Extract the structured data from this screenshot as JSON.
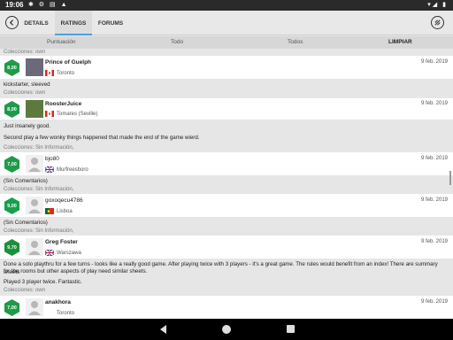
{
  "status": {
    "time": "19:06",
    "icons": "✱ ⚙ ▤ ▲",
    "right": "▾◢ ▮"
  },
  "tabs": {
    "details": "DETAILS",
    "ratings": "RATINGS",
    "forums": "FORUMS"
  },
  "filters": {
    "rating": "Puntuación",
    "all": "Todo",
    "all_pl": "Todos",
    "clear": "LIMPIAR"
  },
  "colors": {
    "green_dark": "#1e9a4a",
    "green_mid": "#2aa84a",
    "accent": "#4aa0d8"
  },
  "ratings": [
    {
      "coleccion": "Colecciones:  own",
      "score": "8,00",
      "username": "Prince of Guelph",
      "location": "Toronto",
      "date": "9 feb. 2019",
      "comment": "kickstarter, sleeved",
      "avatar": "photo",
      "flag": "canada-flag-icon"
    },
    {
      "coleccion": "Colecciones:  own",
      "score": "8,00",
      "username": "RoosterJuice",
      "location": "Tomares (Seville)",
      "date": "9 feb. 2019",
      "comment1": "Just insanely good.",
      "comment2": "Second play a few wonky things happened that made the end of the game wierd.",
      "avatar": "photo",
      "flag": "canada-flag-icon"
    },
    {
      "coleccion": "Colecciones:  Sin Información,",
      "score": "7,00",
      "username": "bjo80",
      "location": "Murfreesboro",
      "date": "9 feb. 2019",
      "comment": "(Sin Comentarios)",
      "avatar": "generic",
      "flag": "uk-flag-icon"
    },
    {
      "coleccion": "Colecciones:  Sin Información,",
      "score": "9,00",
      "username": "goxoqecu4786",
      "location": "Lisboa",
      "date": "9 feb. 2019",
      "comment": "(Sin Comentarios)",
      "avatar": "generic",
      "flag": "portugal-flag-icon"
    },
    {
      "coleccion": "Colecciones:  Sin Información,",
      "score": "9,70",
      "username": "Greg Foster",
      "location": "Warszawa",
      "date": "9 feb. 2019",
      "comment1": "Done a solo playthru for a few turns - looks like a really good game. After playing twice with 3 players - it's a great game. The rules would benefit from an index! There are summary sheets",
      "comment2": "for the rooms but other aspects of play need similar sheets.",
      "comment3": "Played 3 player twice. Fantastic.",
      "avatar": "generic",
      "flag": "uk-flag-icon"
    },
    {
      "coleccion": "Colecciones:  own",
      "score": "7,00",
      "username": "anakhora",
      "location": "Toronto",
      "date": "9 feb. 2019",
      "avatar": "generic",
      "flag": ""
    }
  ]
}
